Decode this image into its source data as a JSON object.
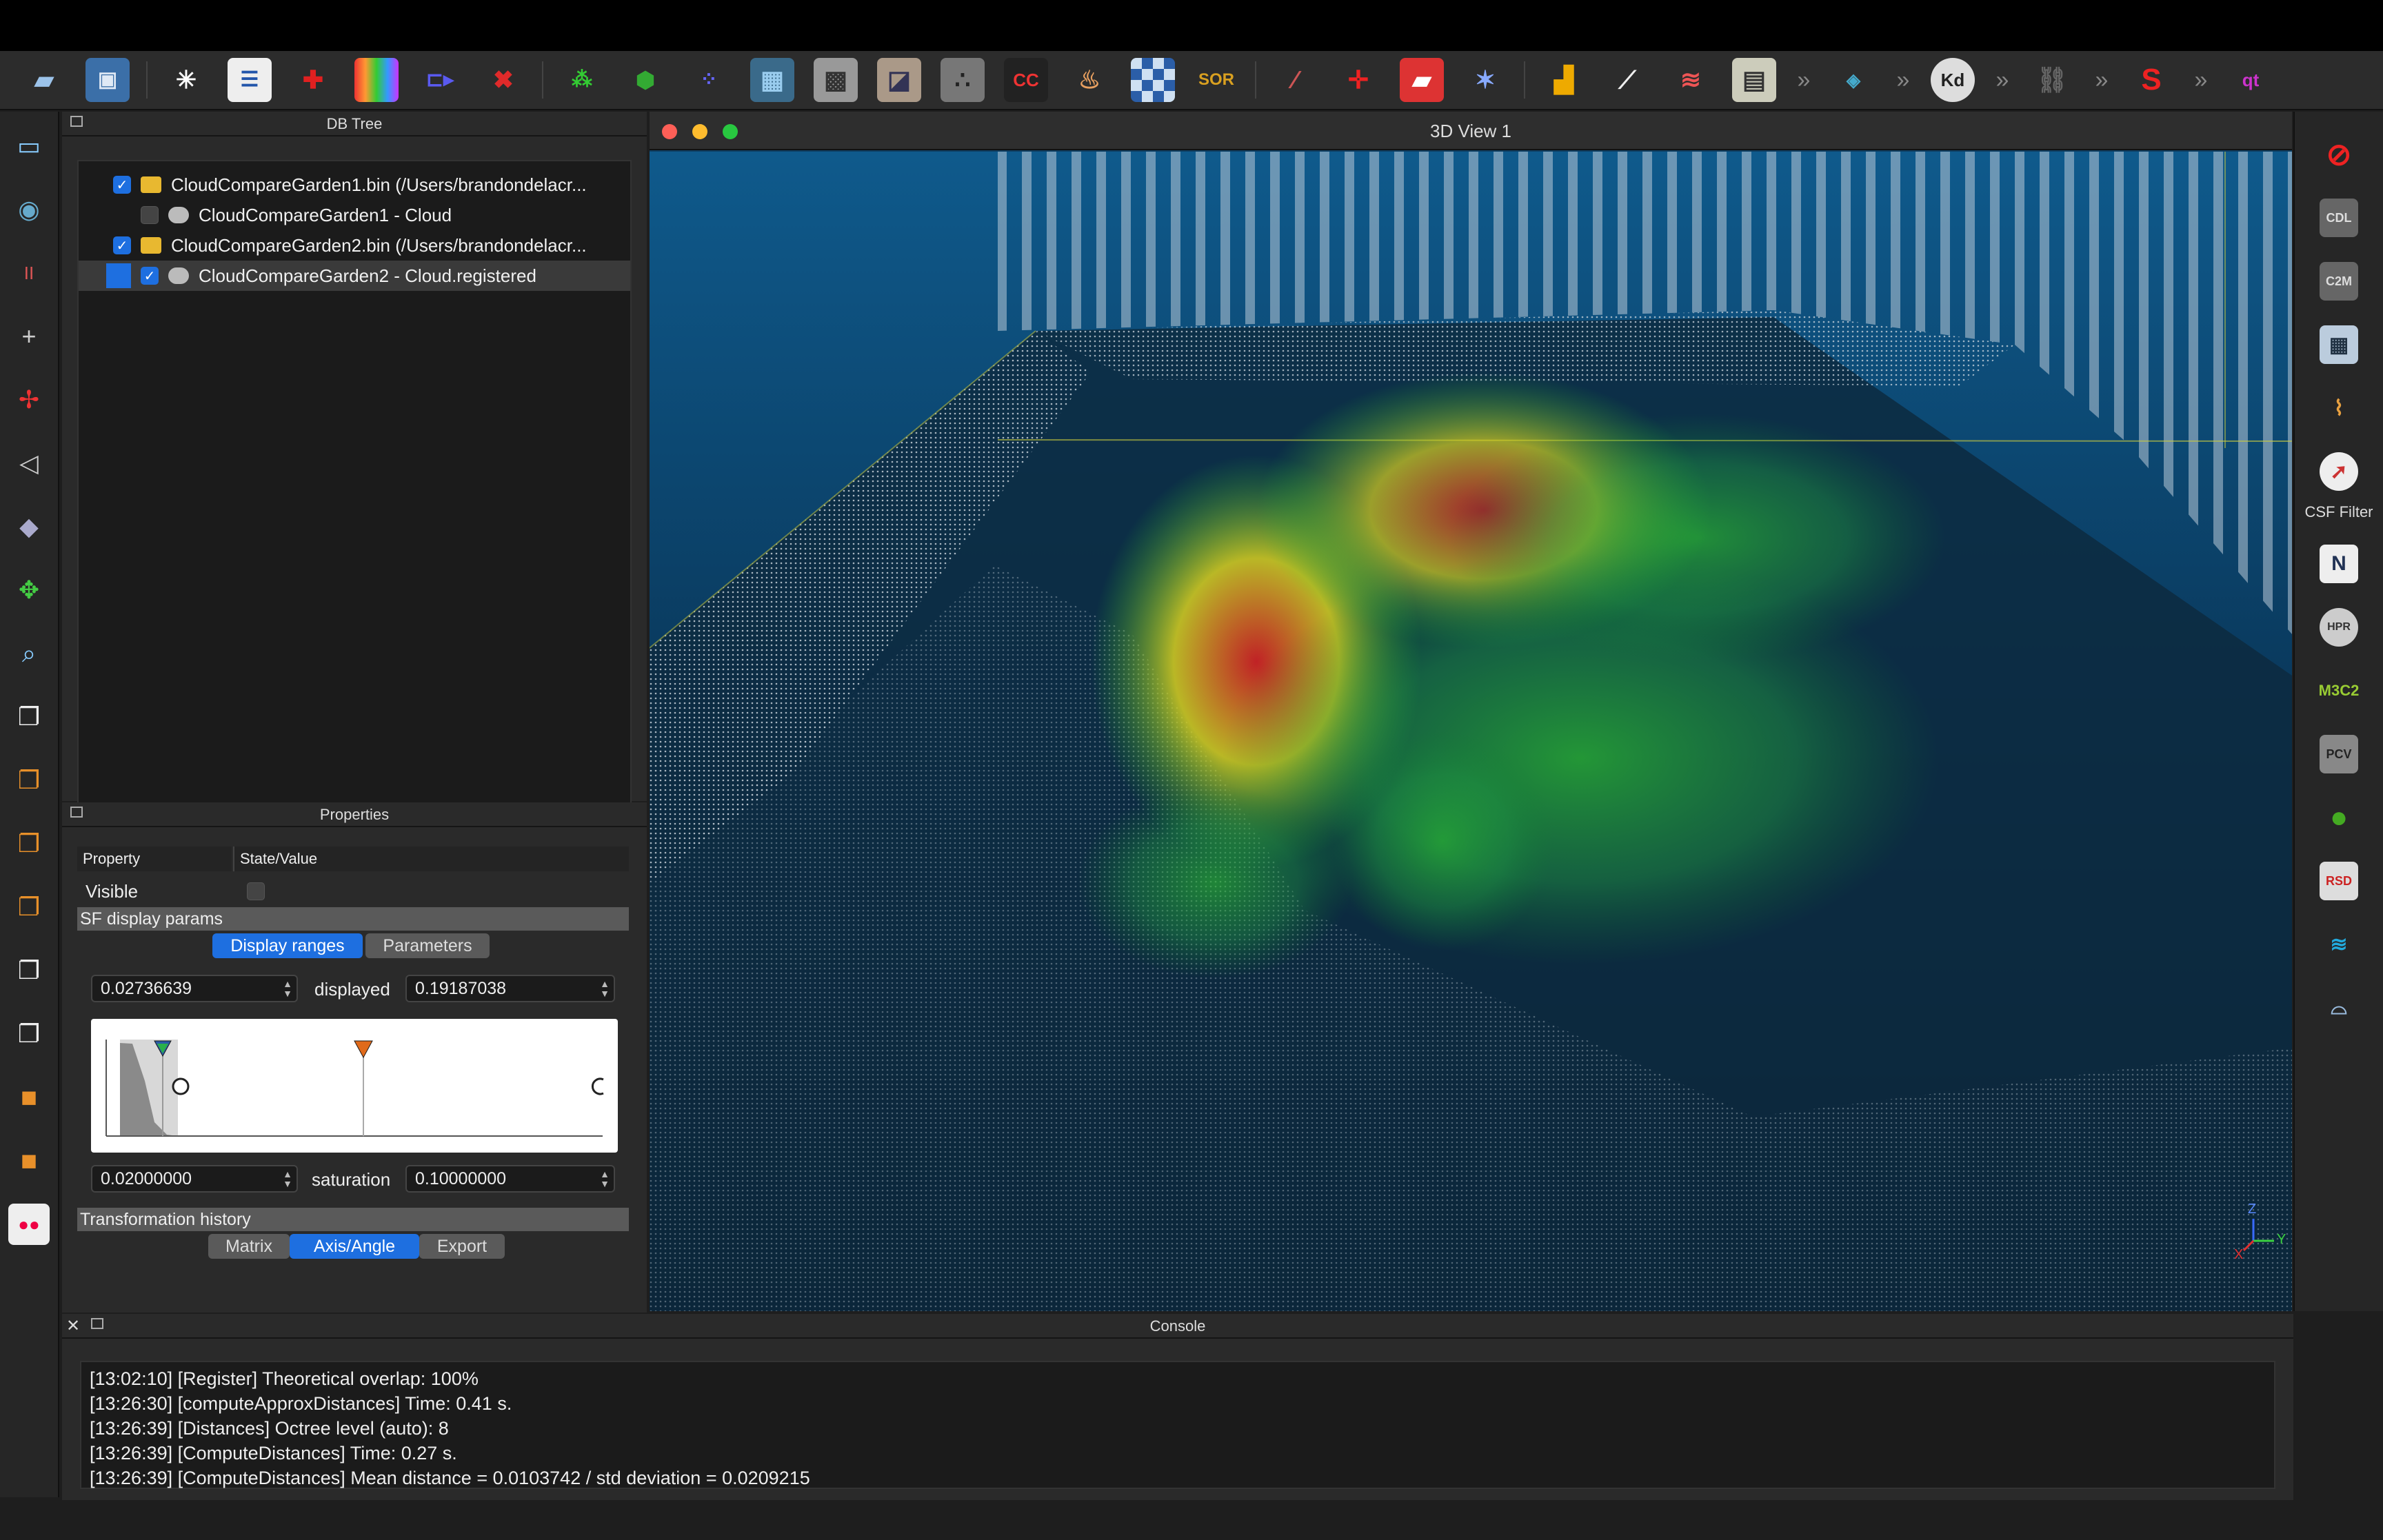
{
  "toolbar": {
    "icons": [
      "open-folder-icon",
      "save-icon",
      "cursor-settings-icon",
      "list-icon",
      "add-point-icon",
      "rgb-image-icon",
      "sf-icon",
      "delete-icon",
      "merge-icon",
      "segment-icon",
      "sample-icon",
      "mesh-icon",
      "subsample-icon",
      "texture-icon",
      "noise-icon",
      "cc-icon",
      "paint-icon",
      "checker-icon",
      "sor-icon",
      "line-icon",
      "crosshair-icon",
      "box-icon",
      "star-icon",
      "histogram-icon",
      "graph-icon",
      "stats-icon",
      "calc-icon",
      "more-icon",
      "canupo-icon",
      "more-icon",
      "kd-icon",
      "more-icon",
      "link-icon",
      "more-icon",
      "s-icon",
      "more-icon",
      "qt-icon"
    ]
  },
  "db_tree": {
    "title": "DB Tree",
    "items": [
      {
        "label": "CloudCompareGarden1.bin (/Users/brandondelacr...",
        "checked": true,
        "type": "folder"
      },
      {
        "label": "CloudCompareGarden1 - Cloud",
        "checked": false,
        "type": "cloud"
      },
      {
        "label": "CloudCompareGarden2.bin (/Users/brandondelacr...",
        "checked": true,
        "type": "folder"
      },
      {
        "label": "CloudCompareGarden2 - Cloud.registered",
        "checked": true,
        "type": "cloud"
      }
    ]
  },
  "properties": {
    "title": "Properties",
    "col_property": "Property",
    "col_value": "State/Value",
    "visible_label": "Visible",
    "sf_section": "SF display params",
    "tabs": [
      "Display ranges",
      "Parameters"
    ],
    "displayed_min": "0.02736639",
    "displayed_label": "displayed",
    "displayed_max": "0.19187038",
    "saturation_min": "0.02000000",
    "saturation_label": "saturation",
    "saturation_max": "0.10000000",
    "transform_section": "Transformation history",
    "transform_tabs": [
      "Matrix",
      "Axis/Angle",
      "Export"
    ]
  },
  "view": {
    "title": "3D View 1",
    "axes": {
      "z": "Z",
      "y": "Y",
      "x": "X"
    }
  },
  "right_toolbar": {
    "csf_label": "CSF Filter"
  },
  "console": {
    "title": "Console",
    "lines": [
      "[13:02:10] [Register] Theoretical overlap: 100%",
      "[13:26:30] [computeApproxDistances] Time: 0.41 s.",
      "[13:26:39] [Distances] Octree level (auto): 8",
      "[13:26:39] [ComputeDistances] Time: 0.27 s.",
      "[13:26:39] [ComputeDistances] Mean distance = 0.0103742 / std deviation = 0.0209215"
    ]
  },
  "colors": {
    "accent": "#1e6fe0",
    "view_bg_top": "#0e5a8a",
    "view_bg_bottom": "#061018",
    "traffic_red": "#fe5f57",
    "traffic_yellow": "#febc2e",
    "traffic_green": "#28c840"
  }
}
